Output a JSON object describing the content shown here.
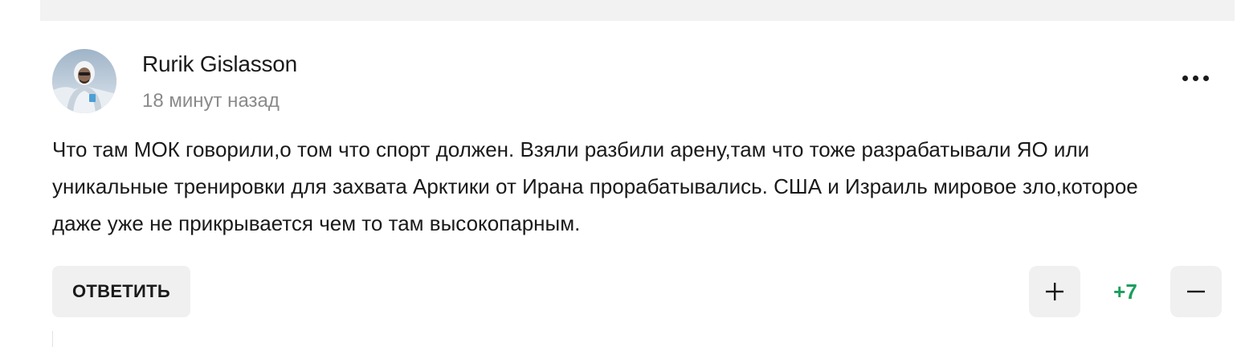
{
  "comment": {
    "author": "Rurik Gislasson",
    "timestamp": "18 минут назад",
    "text": "Что там МОК говорили,о том что спорт должен. Взяли разбили арену,там что тоже разрабатывали ЯО или уникальные тренировки для захвата Арктики от Ирана прорабатывались. США и Израиль мировое зло,которое даже уже не прикрывается чем то там высокопарным.",
    "reply_label": "ОТВЕТИТЬ",
    "rating": "+7",
    "more_icon": "more-horizontal-icon",
    "upvote_icon": "plus-icon",
    "downvote_icon": "minus-icon"
  },
  "colors": {
    "rating_positive": "#1a9e5c",
    "button_bg": "#f0f0f0",
    "timestamp": "#8a8a8a"
  }
}
